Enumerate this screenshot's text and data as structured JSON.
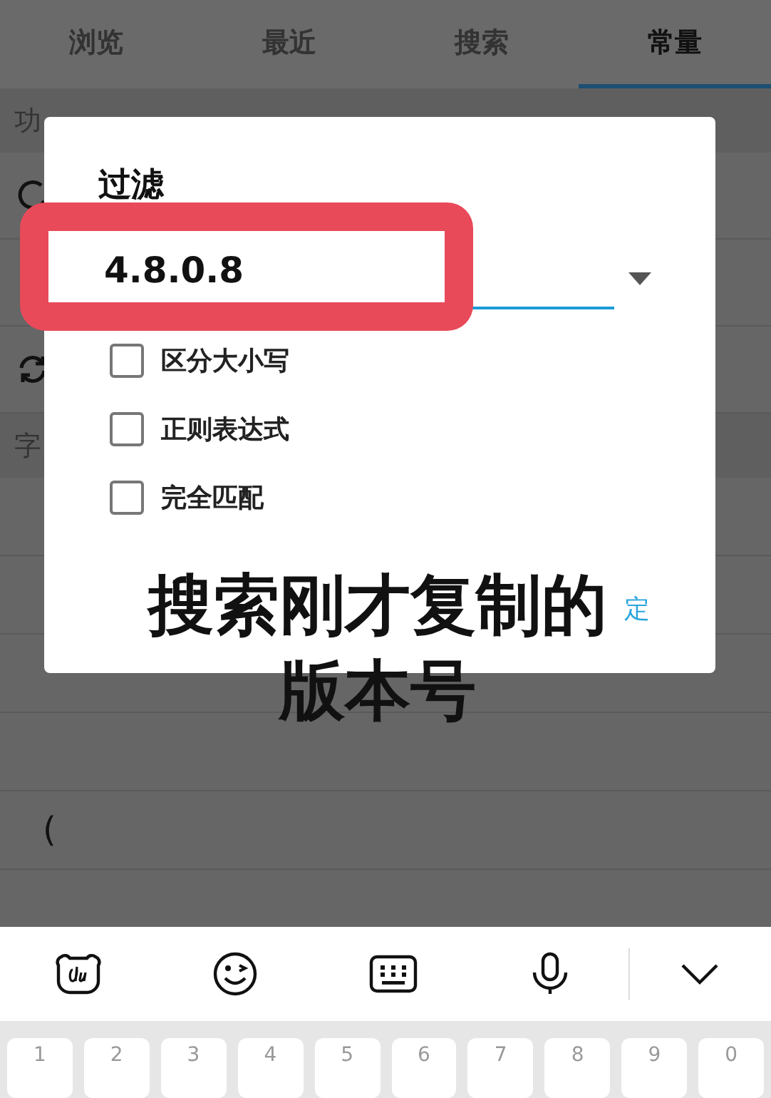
{
  "tabs": [
    {
      "label": "浏览",
      "selected": false
    },
    {
      "label": "最近",
      "selected": false
    },
    {
      "label": "搜索",
      "selected": false
    },
    {
      "label": "常量",
      "selected": true
    }
  ],
  "sections": [
    {
      "header": "功",
      "rows": [
        {
          "kind": "circle"
        },
        {
          "kind": "blank"
        },
        {
          "kind": "refresh"
        }
      ]
    },
    {
      "header": "字",
      "rows": [
        {
          "kind": "blank"
        },
        {
          "kind": "blank"
        },
        {
          "kind": "blank"
        },
        {
          "kind": "blank"
        },
        {
          "kind": "text",
          "text": "("
        },
        {
          "kind": "blank"
        }
      ]
    }
  ],
  "dialog": {
    "title": "过滤",
    "value": "4.8.0.8",
    "options": [
      {
        "label": "区分大小写",
        "checked": false
      },
      {
        "label": "正则表达式",
        "checked": false
      },
      {
        "label": "完全匹配",
        "checked": false
      }
    ],
    "buttons": [
      "定"
    ]
  },
  "annotation": {
    "caption": [
      "搜索刚才复制的",
      "版本号"
    ]
  },
  "keyboard": {
    "tools": [
      {
        "kind": "bear"
      },
      {
        "kind": "emoji"
      },
      {
        "kind": "keyboard"
      },
      {
        "kind": "mic"
      },
      {
        "kind": "collapse"
      }
    ],
    "digits": [
      "1",
      "2",
      "3",
      "4",
      "5",
      "6",
      "7",
      "8",
      "9",
      "0"
    ]
  }
}
